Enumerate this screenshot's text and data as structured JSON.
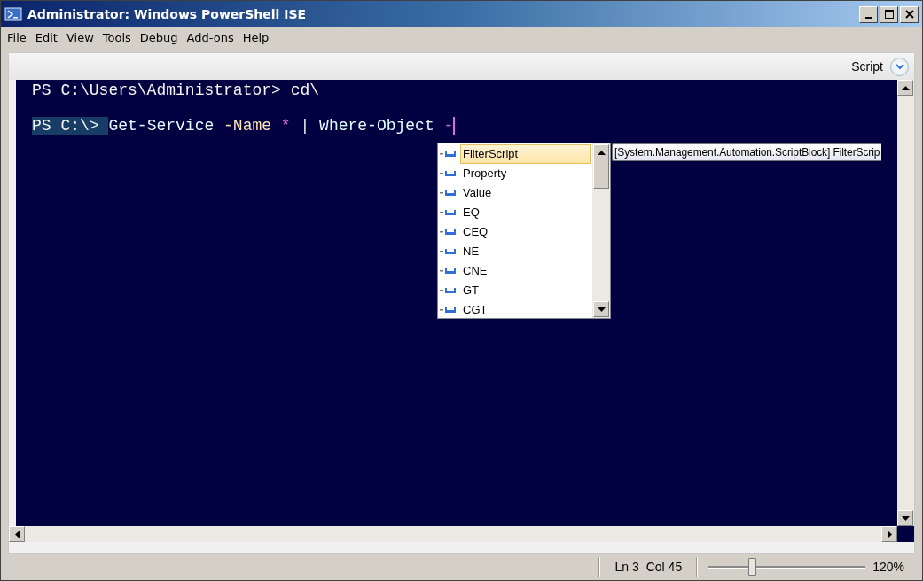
{
  "window": {
    "title": "Administrator: Windows PowerShell ISE"
  },
  "menu": [
    "File",
    "Edit",
    "View",
    "Tools",
    "Debug",
    "Add-ons",
    "Help"
  ],
  "script_bar": {
    "label": "Script"
  },
  "console": {
    "lines": [
      {
        "tokens": [
          {
            "text": "PS C:\\Users\\Administrator> cd\\",
            "kind": "plain",
            "selected": false
          }
        ]
      },
      {
        "tokens": [
          {
            "text": "PS C:\\> ",
            "kind": "plain",
            "selected": true
          },
          {
            "text": "Get-Service ",
            "kind": "command",
            "selected": false
          },
          {
            "text": "-Name ",
            "kind": "parameter",
            "selected": false
          },
          {
            "text": "* ",
            "kind": "operator",
            "selected": false
          },
          {
            "text": "| ",
            "kind": "plain",
            "selected": false
          },
          {
            "text": "Where-Object ",
            "kind": "command",
            "selected": false
          },
          {
            "text": "-",
            "kind": "operator",
            "selected": false
          }
        ]
      }
    ]
  },
  "completion": {
    "items": [
      {
        "label": "FilterScript",
        "selected": true
      },
      {
        "label": "Property",
        "selected": false
      },
      {
        "label": "Value",
        "selected": false
      },
      {
        "label": "EQ",
        "selected": false
      },
      {
        "label": "CEQ",
        "selected": false
      },
      {
        "label": "NE",
        "selected": false
      },
      {
        "label": "CNE",
        "selected": false
      },
      {
        "label": "GT",
        "selected": false
      },
      {
        "label": "CGT",
        "selected": false
      }
    ],
    "tooltip": "[System.Management.Automation.ScriptBlock] FilterScrip"
  },
  "status_bar": {
    "line": "Ln 3",
    "column": "Col 45",
    "zoom": {
      "level": 0.28
    },
    "zoom_label": "120%"
  }
}
